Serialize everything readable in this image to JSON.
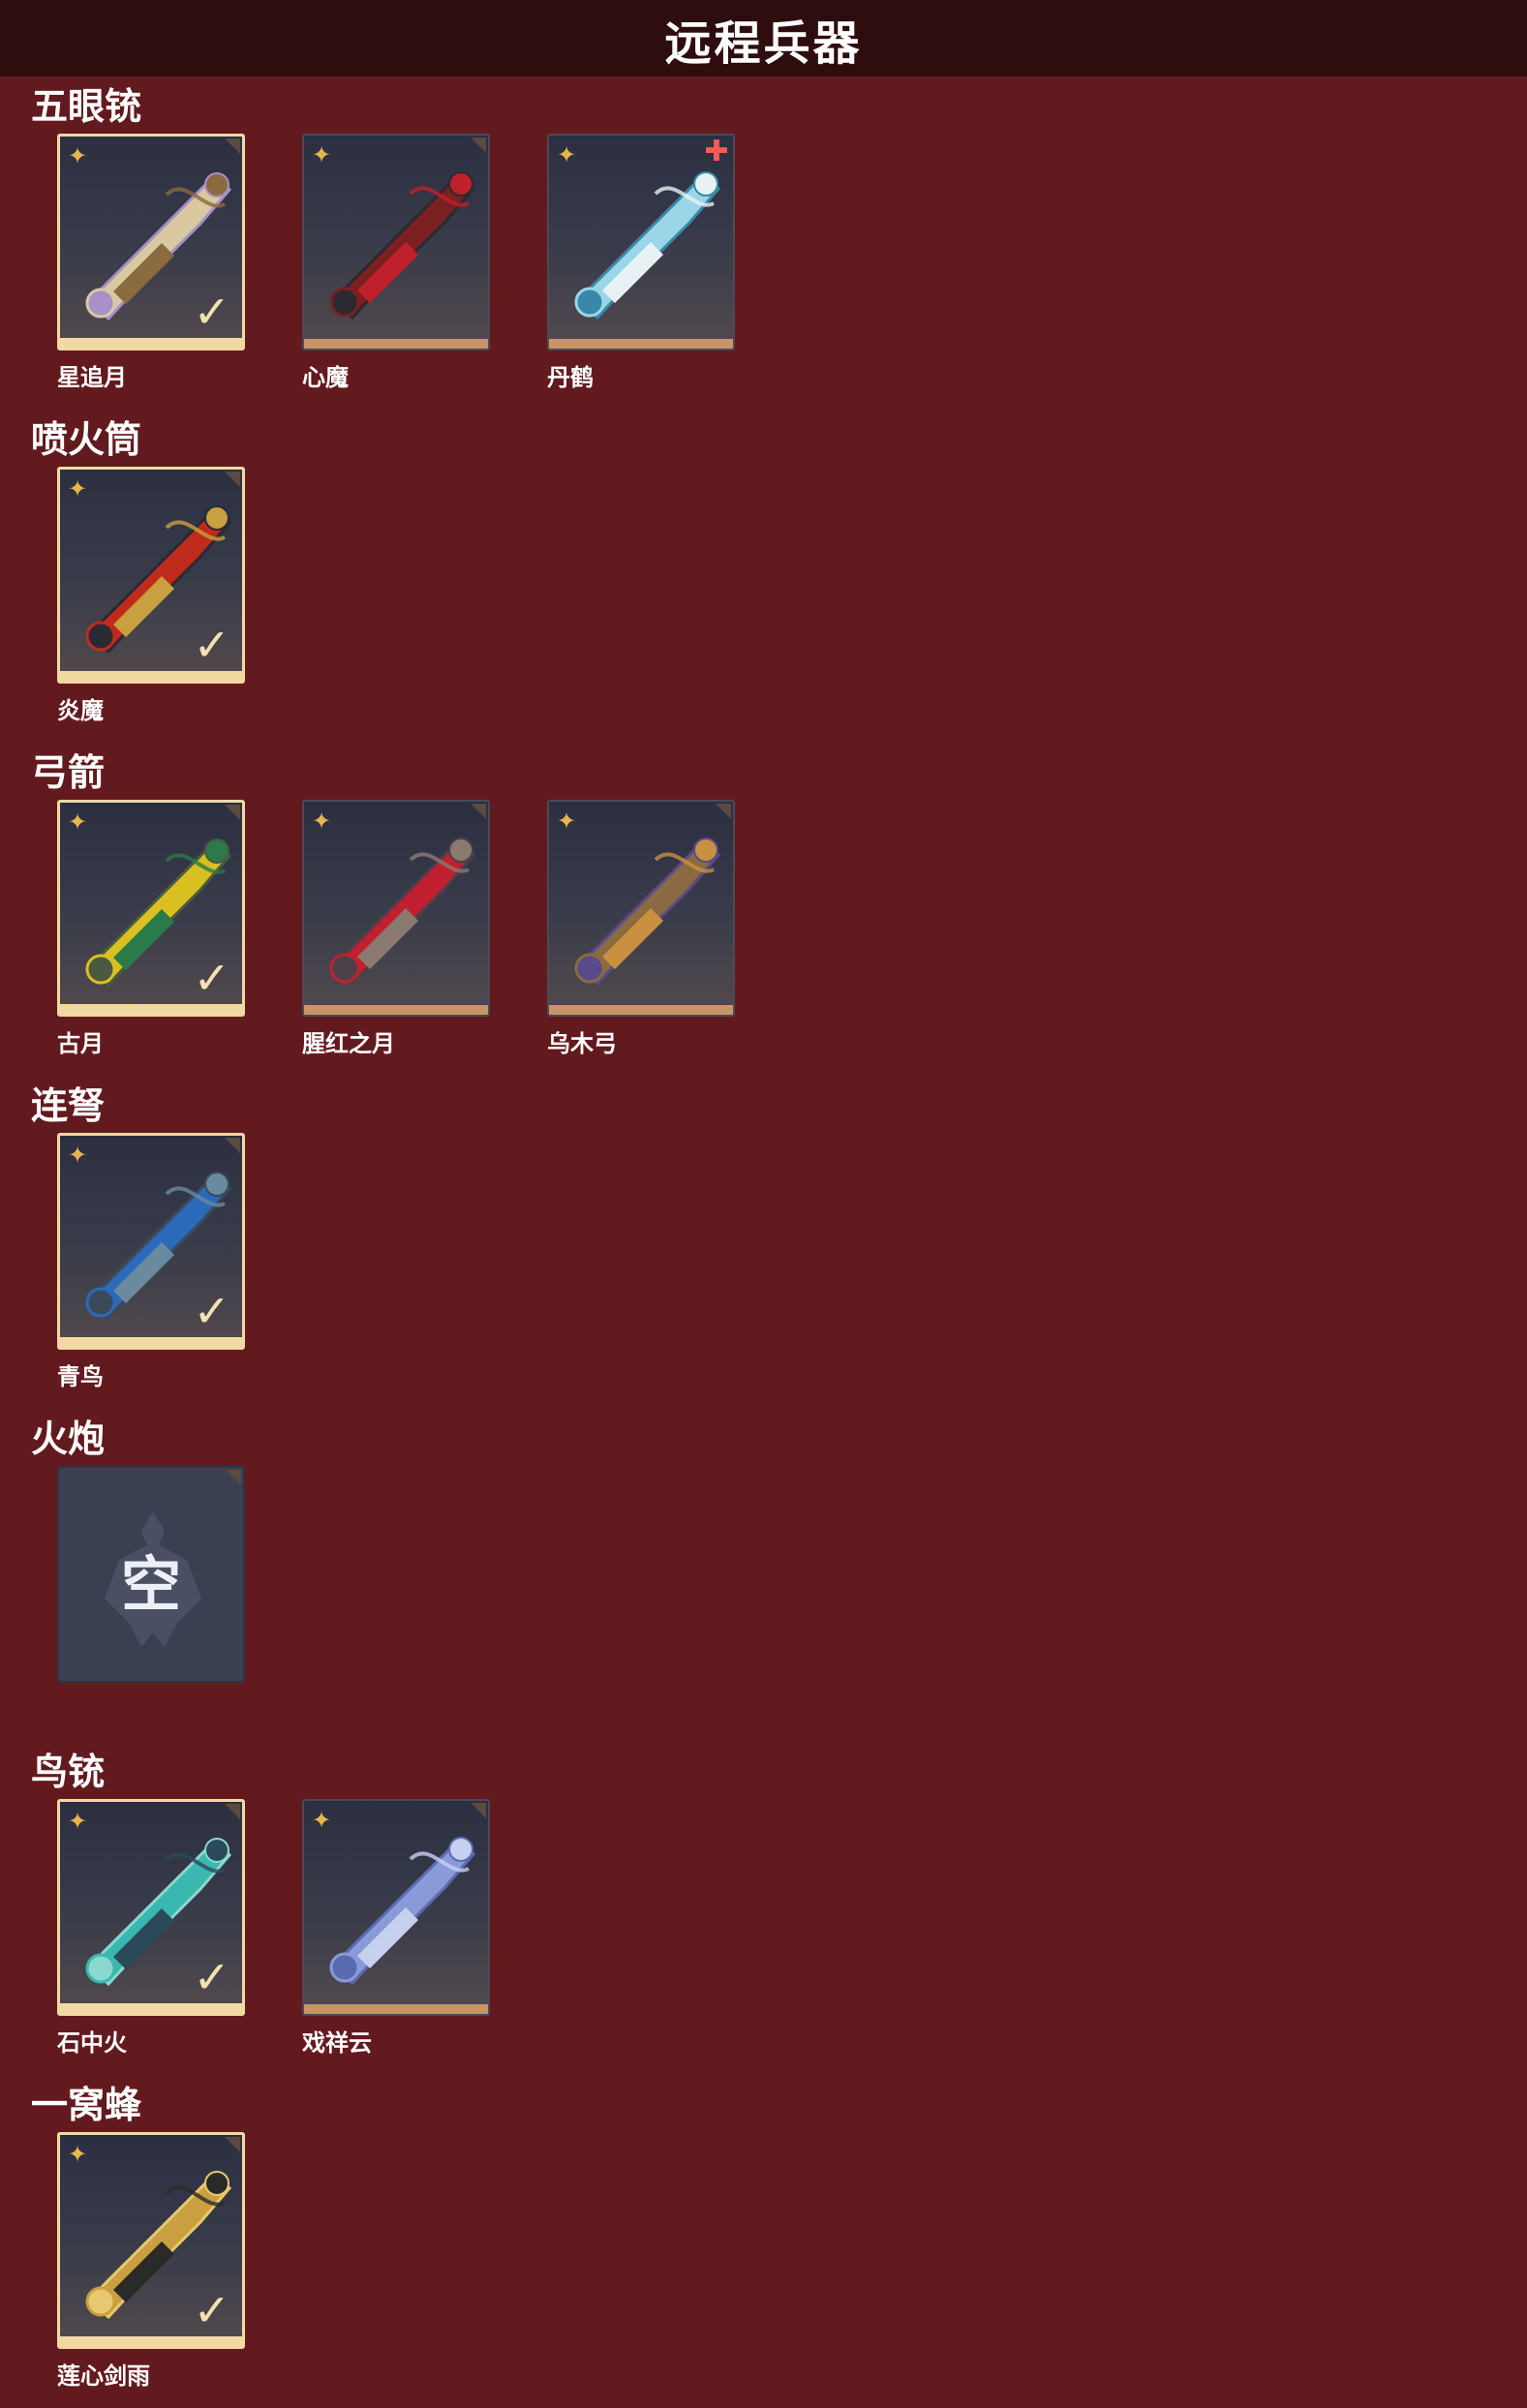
{
  "header": {
    "title": "远程兵器"
  },
  "categories": [
    {
      "title": "五眼铳",
      "items": [
        {
          "name": "星追月",
          "selected": true,
          "plus": false,
          "colors": [
            "#d8c9a0",
            "#8b6a40",
            "#a890c8"
          ]
        },
        {
          "name": "心魔",
          "selected": false,
          "plus": false,
          "colors": [
            "#7a2020",
            "#c0202a",
            "#2a2a30"
          ]
        },
        {
          "name": "丹鹤",
          "selected": false,
          "plus": true,
          "colors": [
            "#9ad6e8",
            "#e8f2f5",
            "#3a88a8"
          ]
        }
      ]
    },
    {
      "title": "喷火筒",
      "items": [
        {
          "name": "炎魔",
          "selected": true,
          "plus": false,
          "colors": [
            "#c02a1a",
            "#c8a040",
            "#2a2a35"
          ]
        }
      ]
    },
    {
      "title": "弓箭",
      "items": [
        {
          "name": "古月",
          "selected": true,
          "plus": false,
          "colors": [
            "#d8c020",
            "#2a7a4a",
            "#4a5a40"
          ]
        },
        {
          "name": "腥红之月",
          "selected": false,
          "plus": false,
          "colors": [
            "#c02030",
            "#8a7a70",
            "#4a4048"
          ]
        },
        {
          "name": "乌木弓",
          "selected": false,
          "plus": false,
          "colors": [
            "#8a6a40",
            "#c89040",
            "#5a4a8a"
          ]
        }
      ]
    },
    {
      "title": "连弩",
      "items": [
        {
          "name": "青鸟",
          "selected": true,
          "plus": false,
          "colors": [
            "#2a6ab8",
            "#6a8aa0",
            "#3a4a5a"
          ]
        }
      ]
    },
    {
      "title": "火炮",
      "items": [
        {
          "name": "",
          "empty": true,
          "empty_label": "空"
        }
      ]
    },
    {
      "title": "鸟铳",
      "items": [
        {
          "name": "石中火",
          "selected": true,
          "plus": false,
          "colors": [
            "#3ab8b0",
            "#2a4a5a",
            "#8ad8d0"
          ]
        },
        {
          "name": "戏祥云",
          "selected": false,
          "plus": false,
          "colors": [
            "#8a9ad8",
            "#c8d0f0",
            "#5a6ab0"
          ]
        }
      ]
    },
    {
      "title": "一窝蜂",
      "items": [
        {
          "name": "莲心剑雨",
          "selected": true,
          "plus": false,
          "colors": [
            "#c8a040",
            "#2a2a2a",
            "#e8c870"
          ]
        }
      ]
    }
  ]
}
